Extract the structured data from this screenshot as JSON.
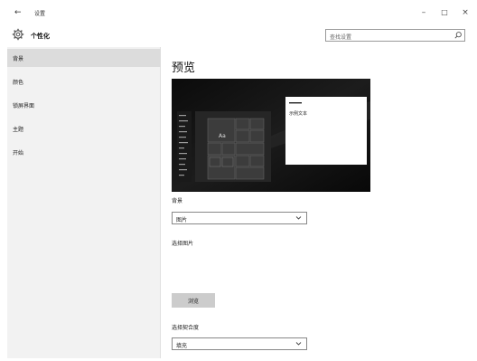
{
  "titlebar": {
    "back": "←",
    "title": "设置",
    "minimize": "–",
    "maximize": "□",
    "close": "×"
  },
  "header": {
    "title": "个性化",
    "search_placeholder": "查找设置"
  },
  "sidebar": {
    "items": [
      {
        "label": "背景",
        "active": true
      },
      {
        "label": "颜色",
        "active": false
      },
      {
        "label": "锁屏界面",
        "active": false
      },
      {
        "label": "主题",
        "active": false
      },
      {
        "label": "开始",
        "active": false
      }
    ]
  },
  "main": {
    "title": "预览",
    "preview": {
      "tile_text": "Aa",
      "window_text": "示例文本"
    },
    "background_label": "背景",
    "background_value": "图片",
    "choose_picture_label": "选择图片",
    "browse_label": "浏览",
    "fit_label": "选择契合度",
    "fit_value": "填充"
  },
  "colors": {
    "sidebar_bg": "#f2f2f2",
    "sidebar_active": "#dcdcdc",
    "browse_bg": "#cccccc"
  }
}
